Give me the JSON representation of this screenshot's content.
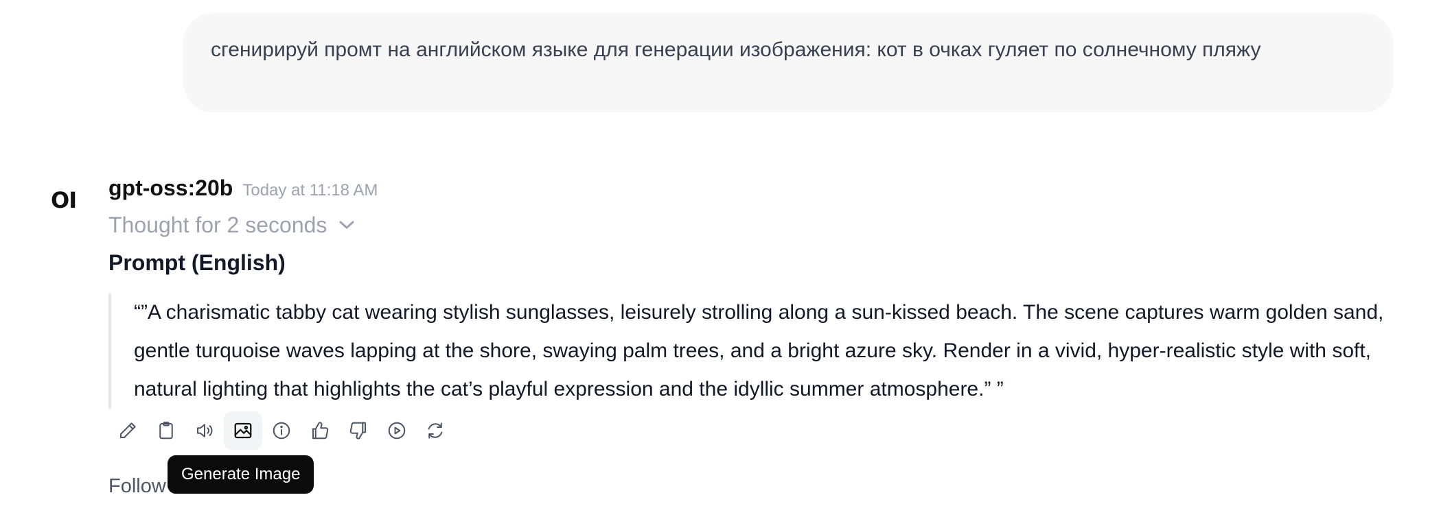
{
  "user_message": {
    "text": "сгенирируй промт на английском языке для генерации изображения: кот в очках гуляет по солнечному пляжу"
  },
  "assistant": {
    "logo": "OI",
    "model_name": "gpt-oss:20b",
    "timestamp": "Today at 11:18 AM",
    "thought_label": "Thought for 2 seconds",
    "heading": "Prompt (English)",
    "quote": "“”A charismatic tabby cat wearing stylish sunglasses, leisurely strolling along a sun‑kissed beach. The scene captures warm golden sand, gentle turquoise waves lapping at the shore, swaying palm trees, and a bright azure sky. Render in a vivid, hyper‑realistic style with soft, natural lighting that highlights the cat’s playful expression and the idyllic summer atmosphere.” ”"
  },
  "toolbar": {
    "icons": [
      "pencil-icon",
      "clipboard-icon",
      "speaker-icon",
      "image-icon",
      "info-icon",
      "thumbs-up-icon",
      "thumbs-down-icon",
      "play-icon",
      "refresh-icon"
    ],
    "active": "image-icon"
  },
  "follow_up_label": "Follow",
  "tooltip": "Generate Image",
  "colors": {
    "bubble_bg": "#f7f7f7",
    "muted": "#9ca3af",
    "tooltip_bg": "#0b0b0b",
    "quote_border": "#e5e7eb"
  }
}
